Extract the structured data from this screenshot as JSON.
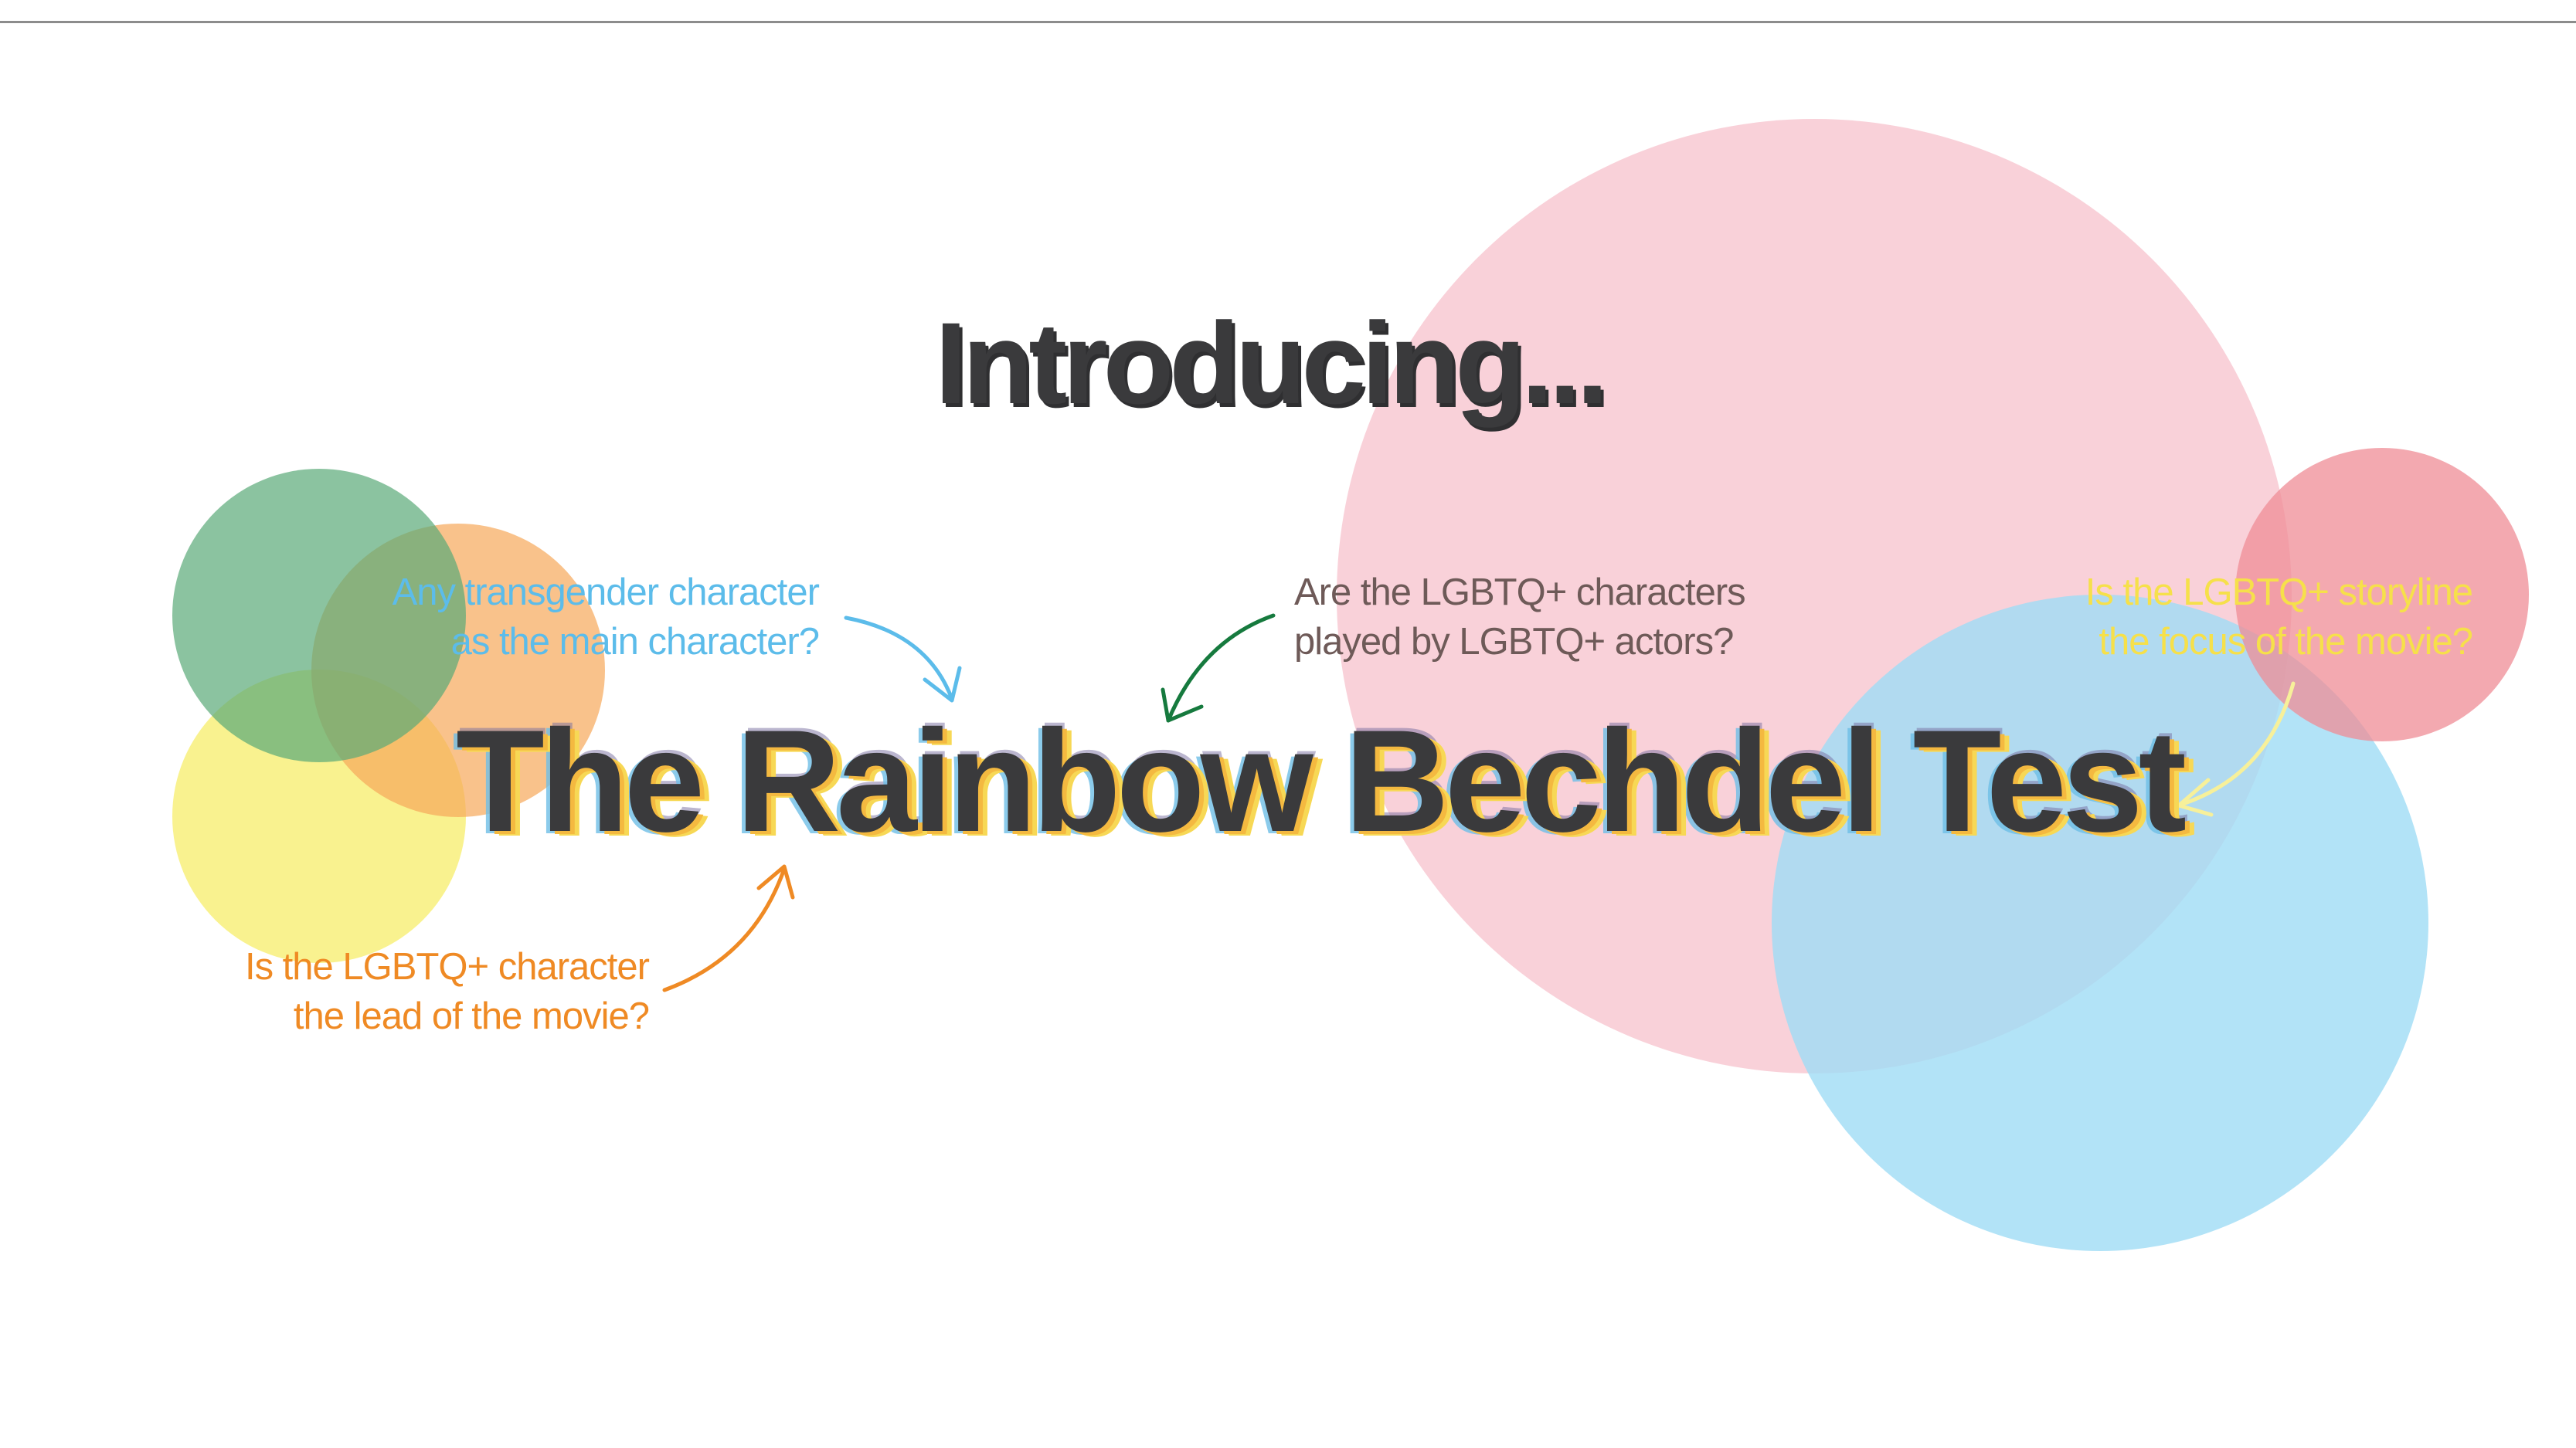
{
  "heading": "Introducing...",
  "title": "The Rainbow Bechdel Test",
  "questions": {
    "transgender": {
      "line1": "Any transgender character",
      "line2": "as the main character?"
    },
    "actors": {
      "line1": "Are the LGBTQ+ characters",
      "line2": "played by LGBTQ+ actors?"
    },
    "focus": {
      "line1": "Is the LGBTQ+ storyline",
      "line2": "the focus of the movie?"
    },
    "lead": {
      "line1": "Is the LGBTQ+ character",
      "line2": "the lead of the movie?"
    }
  },
  "colors": {
    "pink": "#f8c6d0",
    "red": "#ef8c95",
    "blue": "#9fdcf5",
    "green": "#5aa978",
    "orange": "#f7a85a",
    "yellow": "#f7ee6a",
    "text": "#3a3a3c",
    "arrow_blue": "#5cbcea",
    "arrow_green": "#167a3e",
    "arrow_yellow": "#f7f09a",
    "arrow_orange": "#ef8a24"
  }
}
